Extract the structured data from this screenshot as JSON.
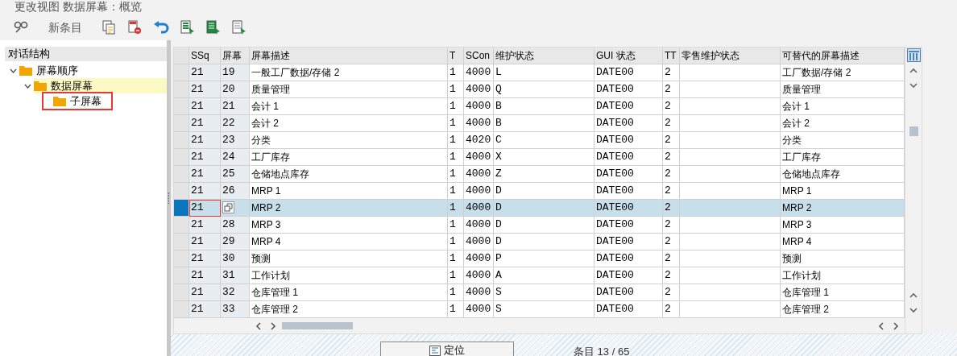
{
  "window": {
    "title": "更改视图 数据屏幕：概览"
  },
  "toolbar": {
    "new_entry": "新条目"
  },
  "tree": {
    "title": "对话结构",
    "items": [
      {
        "label": "屏幕顺序",
        "expanded": true,
        "selected": false,
        "marked": false,
        "children": [
          {
            "label": "数据屏幕",
            "expanded": true,
            "selected": true,
            "marked": false,
            "children": [
              {
                "label": "子屏幕",
                "selected": false,
                "marked": true
              }
            ]
          }
        ]
      }
    ]
  },
  "table": {
    "columns": [
      "SSq",
      "屏幕",
      "屏幕描述",
      "T",
      "SCon",
      "维护状态",
      "GUI 状态",
      "TT",
      "零售维护状态",
      "可替代的屏幕描述"
    ],
    "rows": [
      {
        "ssq": "21",
        "screen": "19",
        "description": "一般工厂数据/存储 2",
        "t": "1",
        "scon": "4000",
        "maint": "L",
        "gui": "DATE00",
        "tt": "2",
        "alt": "工厂数据/存储 2",
        "selected": false,
        "focused": false
      },
      {
        "ssq": "21",
        "screen": "20",
        "description": "质量管理",
        "t": "1",
        "scon": "4000",
        "maint": "Q",
        "gui": "DATE00",
        "tt": "2",
        "alt": "质量管理",
        "selected": false,
        "focused": false
      },
      {
        "ssq": "21",
        "screen": "21",
        "description": "会计 1",
        "t": "1",
        "scon": "4000",
        "maint": "B",
        "gui": "DATE00",
        "tt": "2",
        "alt": "会计 1",
        "selected": false,
        "focused": false
      },
      {
        "ssq": "21",
        "screen": "22",
        "description": "会计 2",
        "t": "1",
        "scon": "4000",
        "maint": "B",
        "gui": "DATE00",
        "tt": "2",
        "alt": "会计 2",
        "selected": false,
        "focused": false
      },
      {
        "ssq": "21",
        "screen": "23",
        "description": "分类",
        "t": "1",
        "scon": "4020",
        "maint": "C",
        "gui": "DATE00",
        "tt": "2",
        "alt": "分类",
        "selected": false,
        "focused": false
      },
      {
        "ssq": "21",
        "screen": "24",
        "description": "工厂库存",
        "t": "1",
        "scon": "4000",
        "maint": "X",
        "gui": "DATE00",
        "tt": "2",
        "alt": "工厂库存",
        "selected": false,
        "focused": false
      },
      {
        "ssq": "21",
        "screen": "25",
        "description": "仓储地点库存",
        "t": "1",
        "scon": "4000",
        "maint": "Z",
        "gui": "DATE00",
        "tt": "2",
        "alt": "仓储地点库存",
        "selected": false,
        "focused": false
      },
      {
        "ssq": "21",
        "screen": "26",
        "description": "MRP 1",
        "t": "1",
        "scon": "4000",
        "maint": "D",
        "gui": "DATE00",
        "tt": "2",
        "alt": "MRP 1",
        "selected": false,
        "focused": false
      },
      {
        "ssq": "21",
        "description": "MRP 2",
        "t": "1",
        "scon": "4000",
        "maint": "D",
        "gui": "DATE00",
        "tt": "2",
        "alt": "MRP 2",
        "selected": true,
        "focused": true
      },
      {
        "ssq": "21",
        "screen": "28",
        "description": "MRP 3",
        "t": "1",
        "scon": "4000",
        "maint": "D",
        "gui": "DATE00",
        "tt": "2",
        "alt": "MRP 3",
        "selected": false,
        "focused": false
      },
      {
        "ssq": "21",
        "screen": "29",
        "description": "MRP 4",
        "t": "1",
        "scon": "4000",
        "maint": "D",
        "gui": "DATE00",
        "tt": "2",
        "alt": "MRP 4",
        "selected": false,
        "focused": false
      },
      {
        "ssq": "21",
        "screen": "30",
        "description": "预测",
        "t": "1",
        "scon": "4000",
        "maint": "P",
        "gui": "DATE00",
        "tt": "2",
        "alt": "预测",
        "selected": false,
        "focused": false
      },
      {
        "ssq": "21",
        "screen": "31",
        "description": "工作计划",
        "t": "1",
        "scon": "4000",
        "maint": "A",
        "gui": "DATE00",
        "tt": "2",
        "alt": "工作计划",
        "selected": false,
        "focused": false
      },
      {
        "ssq": "21",
        "screen": "32",
        "description": "仓库管理 1",
        "t": "1",
        "scon": "4000",
        "maint": "S",
        "gui": "DATE00",
        "tt": "2",
        "alt": "仓库管理 1",
        "selected": false,
        "focused": false
      },
      {
        "ssq": "21",
        "screen": "33",
        "description": "仓库管理 2",
        "t": "1",
        "scon": "4000",
        "maint": "S",
        "gui": "DATE00",
        "tt": "2",
        "alt": "仓库管理 2",
        "selected": false,
        "focused": false
      }
    ]
  },
  "footer": {
    "position_button": "定位",
    "entry_count": "条目 13 / 65"
  }
}
